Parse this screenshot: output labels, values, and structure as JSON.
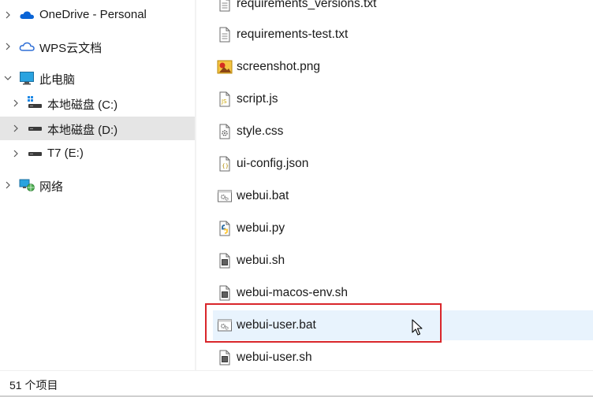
{
  "nav": {
    "items": [
      {
        "label": "OneDrive - Personal",
        "icon": "onedrive-cloud-icon",
        "expand_state": "collapsed",
        "selected": false
      },
      {
        "label": "WPS云文档",
        "icon": "wps-cloud-icon",
        "expand_state": "collapsed",
        "selected": false
      },
      {
        "label": "此电脑",
        "icon": "this-pc-monitor-icon",
        "expand_state": "expanded",
        "selected": false
      },
      {
        "label": "本地磁盘 (C:)",
        "icon": "system-drive-icon",
        "expand_state": "collapsed",
        "selected": false
      },
      {
        "label": "本地磁盘 (D:)",
        "icon": "drive-icon",
        "expand_state": "collapsed",
        "selected": true
      },
      {
        "label": "T7 (E:)",
        "icon": "drive-icon",
        "expand_state": "collapsed",
        "selected": false
      },
      {
        "label": "网络",
        "icon": "network-icon",
        "expand_state": "collapsed",
        "selected": false
      }
    ]
  },
  "files": [
    {
      "name": "requirements_versions.txt",
      "type": "text"
    },
    {
      "name": "requirements-test.txt",
      "type": "text"
    },
    {
      "name": "screenshot.png",
      "type": "image"
    },
    {
      "name": "script.js",
      "type": "js"
    },
    {
      "name": "style.css",
      "type": "css"
    },
    {
      "name": "ui-config.json",
      "type": "json"
    },
    {
      "name": "webui.bat",
      "type": "bat"
    },
    {
      "name": "webui.py",
      "type": "python"
    },
    {
      "name": "webui.sh",
      "type": "shell"
    },
    {
      "name": "webui-macos-env.sh",
      "type": "shell"
    },
    {
      "name": "webui-user.bat",
      "type": "bat",
      "hovered": true
    },
    {
      "name": "webui-user.sh",
      "type": "shell"
    }
  ],
  "status": {
    "item_count": "51 个项目"
  },
  "colors": {
    "selected_bg": "#e5e5e5",
    "hover_bg": "#e8f3fd",
    "highlight_border": "#d9262b",
    "onedrive_blue": "#0a64d6",
    "drive_dark": "#3a3a3a"
  }
}
